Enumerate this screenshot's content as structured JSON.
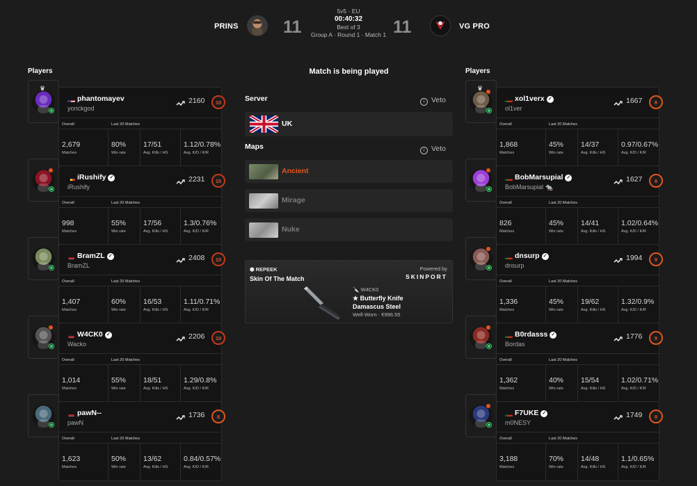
{
  "header": {
    "team_left": "PRINS",
    "team_right": "VG PRO",
    "score_left": "11",
    "score_right": "11",
    "mode": "5v5 · EU",
    "time": "00:40:32",
    "format": "Best of 3",
    "stage": "Group A · Round 1 · Match 1"
  },
  "left_title": "Players",
  "right_title": "Players",
  "center": {
    "status": "Match is being played",
    "server_label": "Server",
    "veto_label": "Veto",
    "server_name": "UK",
    "maps_label": "Maps",
    "maps": [
      {
        "name": "Ancient",
        "color": "#e2561d"
      },
      {
        "name": "Mirage",
        "color": "#7a7a7a"
      },
      {
        "name": "Nuke",
        "color": "#7a7a7a"
      }
    ],
    "skin": {
      "brand": "REPEEK",
      "title": "Skin Of The Match",
      "powered_by": "Powered by",
      "sponsor": "SKINPORT",
      "owner": "W4CK0",
      "item_line1": "★ Butterfly Knife",
      "item_line2": "Damascus Steel",
      "condition_price": "Well-Worn · €996.55"
    }
  },
  "stat_labels": {
    "overall": "Overall",
    "last20": "Last 20 Matches",
    "matches": "Matches",
    "win_rate": "Win rate",
    "kills": "Avg. Kills / HS",
    "kd": "Avg. K/D / K/R"
  },
  "left_players": [
    {
      "name": "phantomayev",
      "real": "yorickgod",
      "elo": "2160",
      "level": "10",
      "flag": "us",
      "verified": false,
      "matches": "2,679",
      "win": "80%",
      "kills": "17/51",
      "kd": "1.12/0.78%",
      "avatar_color": "#6a2bbd",
      "captain": true
    },
    {
      "name": "iRushify",
      "real": "iRushify",
      "elo": "2231",
      "level": "10",
      "flag": "be",
      "verified": true,
      "matches": "998",
      "win": "55%",
      "kills": "17/56",
      "kd": "1.3/0.76%",
      "avatar_color": "#8a1424",
      "captain": false
    },
    {
      "name": "BramZL",
      "real": "BramZL",
      "elo": "2408",
      "level": "10",
      "flag": "nl",
      "verified": true,
      "matches": "1,407",
      "win": "60%",
      "kills": "16/53",
      "kd": "1.11/0.71%",
      "avatar_color": "#7b8a5e",
      "captain": false
    },
    {
      "name": "W4CK0",
      "real": "Wacko",
      "elo": "2206",
      "level": "10",
      "flag": "nl",
      "verified": true,
      "matches": "1,014",
      "win": "55%",
      "kills": "18/51",
      "kd": "1.29/0.8%",
      "avatar_color": "#555555",
      "captain": false
    },
    {
      "name": "pawN--",
      "real": "pawN",
      "elo": "1736",
      "level": "8",
      "flag": "nl",
      "verified": false,
      "matches": "1,623",
      "win": "50%",
      "kills": "13/62",
      "kd": "0.84/0.57%",
      "avatar_color": "#4a6a7a",
      "captain": false
    }
  ],
  "right_players": [
    {
      "name": "xol1verx",
      "real": "ol1ver",
      "elo": "1667",
      "level": "8",
      "flag": "pt",
      "verified": true,
      "matches": "1,868",
      "win": "45%",
      "kills": "14/37",
      "kd": "0.97/0.67%",
      "avatar_color": "#6e5a46",
      "captain": true
    },
    {
      "name": "BobMarsupial",
      "real": "BobMarsupial 🐀",
      "elo": "1627",
      "level": "8",
      "flag": "pt",
      "verified": true,
      "matches": "826",
      "win": "45%",
      "kills": "14/41",
      "kd": "1.02/0.64%",
      "avatar_color": "#9b3fd6",
      "captain": false
    },
    {
      "name": "dnsurp",
      "real": "dnsurp",
      "elo": "1994",
      "level": "9",
      "flag": "pt",
      "verified": true,
      "matches": "1,336",
      "win": "45%",
      "kills": "19/62",
      "kd": "1.32/0.9%",
      "avatar_color": "#8a5a54",
      "captain": false
    },
    {
      "name": "B0rdasss",
      "real": "Bordas",
      "elo": "1776",
      "level": "9",
      "flag": "pt",
      "verified": true,
      "matches": "1,362",
      "win": "40%",
      "kills": "15/54",
      "kd": "1.02/0.71%",
      "avatar_color": "#8a2a22",
      "captain": false
    },
    {
      "name": "F7UKE",
      "real": "m0NESY",
      "elo": "1749",
      "level": "8",
      "flag": "pt",
      "verified": true,
      "matches": "3,188",
      "win": "70%",
      "kills": "14/48",
      "kd": "1.1/0.65%",
      "avatar_color": "#2a3a7a",
      "captain": false
    }
  ]
}
